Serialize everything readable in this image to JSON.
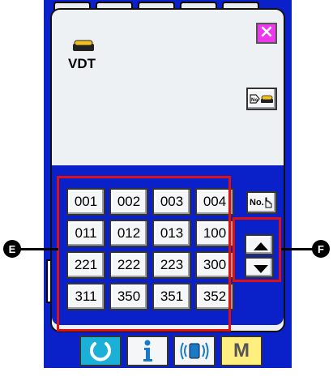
{
  "dialog": {
    "close_label": "×",
    "media_label": "VDT"
  },
  "grid": {
    "buttons": [
      "001",
      "002",
      "003",
      "004",
      "011",
      "012",
      "013",
      "100",
      "221",
      "222",
      "223",
      "300",
      "311",
      "350",
      "351",
      "352"
    ]
  },
  "bottom_bar": {
    "mode_label": "M"
  },
  "callouts": {
    "left": "E",
    "right": "F"
  },
  "colors": {
    "screen_blue": "#0a20c8",
    "highlight_red": "#e01010",
    "close_magenta": "#ee38ee",
    "reset_cyan": "#1ab0d8",
    "mode_yellow": "#ffee80"
  }
}
